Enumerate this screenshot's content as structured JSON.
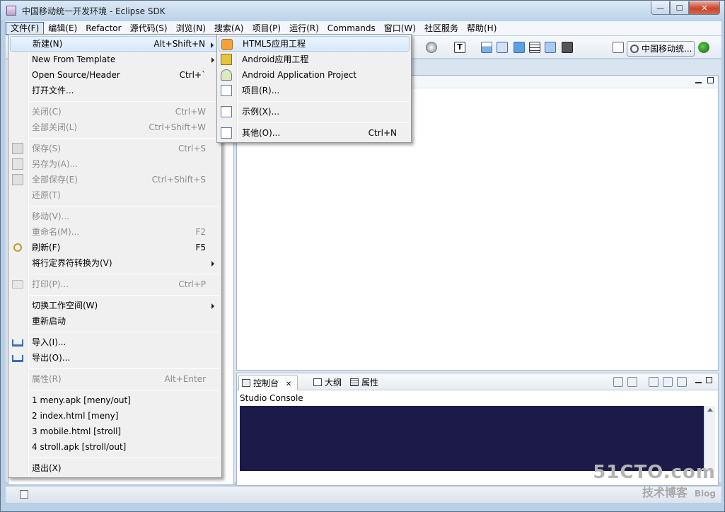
{
  "window": {
    "title": "中国移动统一开发环境 - Eclipse SDK",
    "btn_min": "—",
    "btn_max": "☐",
    "btn_close": "✕"
  },
  "menubar": [
    "文件(F)",
    "编辑(E)",
    "Refactor",
    "源代码(S)",
    "浏览(N)",
    "搜索(A)",
    "项目(P)",
    "运行(R)",
    "Commands",
    "窗口(W)",
    "社区服务",
    "帮助(H)"
  ],
  "toolbar": {
    "perspective_label": "中国移动统...",
    "icons": [
      "run-icon",
      "text-format-icon",
      "view-panel-icon",
      "toggle-icon",
      "window-icon",
      "list-icon",
      "link-icon",
      "pin-icon",
      "new-icon",
      "perspective-icon"
    ]
  },
  "file_menu": {
    "new": {
      "label": "新建(N)",
      "shortcut": "Alt+Shift+N"
    },
    "new_from_template": {
      "label": "New From Template"
    },
    "open_source_header": {
      "label": "Open Source/Header",
      "shortcut": "Ctrl+`"
    },
    "open_file": {
      "label": "打开文件..."
    },
    "close": {
      "label": "关闭(C)",
      "shortcut": "Ctrl+W"
    },
    "close_all": {
      "label": "全部关闭(L)",
      "shortcut": "Ctrl+Shift+W"
    },
    "save": {
      "label": "保存(S)",
      "shortcut": "Ctrl+S"
    },
    "save_as": {
      "label": "另存为(A)..."
    },
    "save_all": {
      "label": "全部保存(E)",
      "shortcut": "Ctrl+Shift+S"
    },
    "revert": {
      "label": "还原(T)"
    },
    "move": {
      "label": "移动(V)..."
    },
    "rename": {
      "label": "重命名(M)...",
      "shortcut": "F2"
    },
    "refresh": {
      "label": "刷新(F)",
      "shortcut": "F5"
    },
    "convert_line": {
      "label": "将行定界符转换为(V)"
    },
    "print": {
      "label": "打印(P)...",
      "shortcut": "Ctrl+P"
    },
    "switch_workspace": {
      "label": "切换工作空间(W)"
    },
    "restart": {
      "label": "重新启动"
    },
    "import": {
      "label": "导入(I)..."
    },
    "export": {
      "label": "导出(O)..."
    },
    "properties": {
      "label": "属性(R)",
      "shortcut": "Alt+Enter"
    },
    "recent": [
      "1 meny.apk  [meny/out]",
      "2 index.html  [meny]",
      "3 mobile.html  [stroll]",
      "4 stroll.apk  [stroll/out]"
    ],
    "exit": {
      "label": "退出(X)"
    }
  },
  "new_submenu": {
    "html5": "HTML5应用工程",
    "android": "Android应用工程",
    "android_app": "Android Application Project",
    "project": "项目(R)...",
    "example": "示例(X)...",
    "other": {
      "label": "其他(O)...",
      "shortcut": "Ctrl+N"
    }
  },
  "console": {
    "tabs": [
      {
        "label": "控制台",
        "close": "✕"
      },
      {
        "label": "大纲"
      },
      {
        "label": "属性"
      }
    ],
    "title": "Studio Console"
  },
  "watermark": {
    "line1": "51CTO.com",
    "line2": "技术博客",
    "line3": "Blog"
  },
  "colors": {
    "console_bg": "#1c1a48",
    "menu_bg": "#f0f0f0",
    "highlight": "#d8e9fb"
  }
}
